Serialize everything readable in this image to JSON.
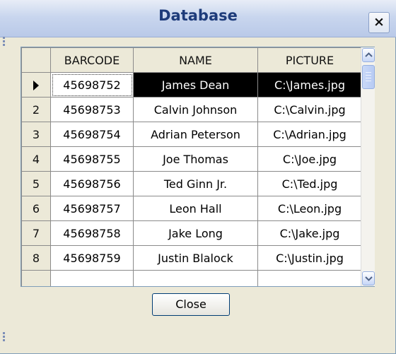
{
  "window": {
    "title": "Database",
    "close_glyph": "×",
    "close_button_label": "Close"
  },
  "grid": {
    "columns": [
      "BARCODE",
      "NAME",
      "PICTURE"
    ],
    "selected_row_marker": "▶",
    "rows": [
      {
        "row_label": "",
        "barcode": "45698752",
        "name": "James Dean",
        "picture": "C:\\James.jpg"
      },
      {
        "row_label": "2",
        "barcode": "45698753",
        "name": "Calvin Johnson",
        "picture": "C:\\Calvin.jpg"
      },
      {
        "row_label": "3",
        "barcode": "45698754",
        "name": "Adrian Peterson",
        "picture": "C:\\Adrian.jpg"
      },
      {
        "row_label": "4",
        "barcode": "45698755",
        "name": "Joe Thomas",
        "picture": "C:\\Joe.jpg"
      },
      {
        "row_label": "5",
        "barcode": "45698756",
        "name": "Ted Ginn Jr.",
        "picture": "C:\\Ted.jpg"
      },
      {
        "row_label": "6",
        "barcode": "45698757",
        "name": "Leon Hall",
        "picture": "C:\\Leon.jpg"
      },
      {
        "row_label": "7",
        "barcode": "45698758",
        "name": "Jake Long",
        "picture": "C:\\Jake.jpg"
      },
      {
        "row_label": "8",
        "barcode": "45698759",
        "name": "Justin Blalock",
        "picture": "C:\\Justin.jpg"
      }
    ]
  },
  "icons": {
    "close": "close-icon",
    "row_pointer": "row-pointer-icon",
    "scroll_up": "chevron-up-icon",
    "scroll_down": "chevron-down-icon",
    "grip": "grip-icon"
  },
  "colors": {
    "title_text": "#1d3b7a",
    "selection_bg": "#000000",
    "selection_fg": "#ffffff",
    "header_bg": "#ece9d8",
    "scroll_accent": "#96b0e0"
  }
}
